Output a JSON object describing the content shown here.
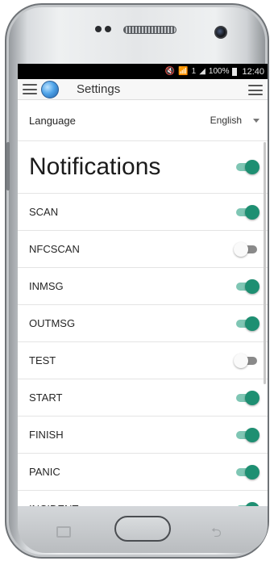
{
  "status_bar": {
    "battery_pct": "100%",
    "time": "12:40",
    "sim_label": "1"
  },
  "toolbar": {
    "title": "Settings",
    "left_menu_icon": "hamburger-menu-icon",
    "app_icon": "globe-icon",
    "right_menu_icon": "hamburger-menu-icon"
  },
  "language": {
    "label": "Language",
    "value": "English"
  },
  "notifications": {
    "title": "Notifications",
    "enabled": true
  },
  "options": [
    {
      "label": "SCAN",
      "enabled": true
    },
    {
      "label": "NFCSCAN",
      "enabled": false
    },
    {
      "label": "INMSG",
      "enabled": true
    },
    {
      "label": "OUTMSG",
      "enabled": true
    },
    {
      "label": "TEST",
      "enabled": false
    },
    {
      "label": "START",
      "enabled": true
    },
    {
      "label": "FINISH",
      "enabled": true
    },
    {
      "label": "PANIC",
      "enabled": true
    },
    {
      "label": "INCIDENT",
      "enabled": true
    }
  ],
  "colors": {
    "toggle_on": "#1e8f72",
    "toggle_on_track": "#7fc6b4",
    "toggle_off_track": "#8a8a8a"
  }
}
